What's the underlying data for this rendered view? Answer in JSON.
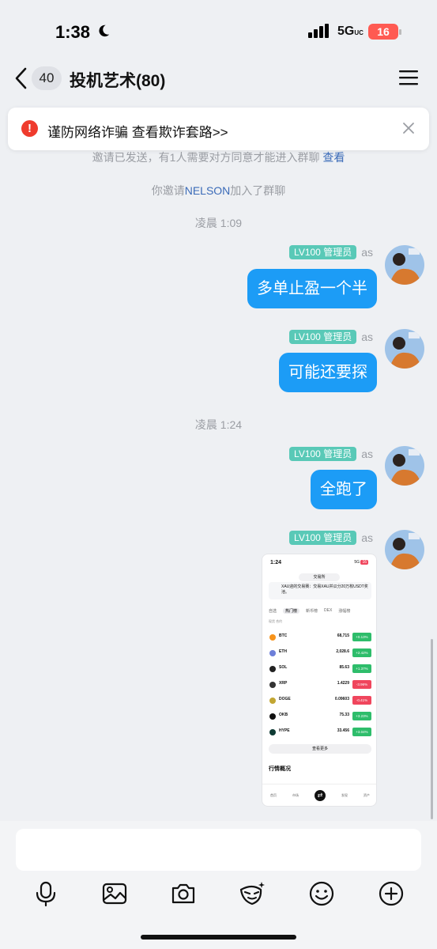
{
  "status_bar": {
    "time": "1:38",
    "network": "5G",
    "network_suffix": "UC",
    "battery": "16"
  },
  "header": {
    "back_count": "40",
    "title": "投机艺术(80)"
  },
  "alert": {
    "text": "谨防网络诈骗 查看欺诈套路>>"
  },
  "system_messages": [
    {
      "text": "邀请已发送，有1人需要对方同意才能进入群聊",
      "link": "查看"
    },
    {
      "text_before": "你邀请",
      "highlight": "NELSON",
      "text_after": "加入了群聊"
    }
  ],
  "time_separators": [
    "凌晨 1:09",
    "凌晨 1:24"
  ],
  "messages": [
    {
      "level": "LV100 管理员",
      "sender": "as",
      "text": "多单止盈一个半"
    },
    {
      "level": "LV100 管理员",
      "sender": "as",
      "text": "可能还要探"
    },
    {
      "level": "LV100 管理员",
      "sender": "as",
      "text": "全跑了"
    },
    {
      "level": "LV100 管理员",
      "sender": "as",
      "type": "image"
    }
  ],
  "shared_screenshot": {
    "time": "1:24",
    "status": "5G",
    "battery": "16",
    "header": "交易所",
    "promo": "XAU迎的交易赛：交易XAU并瓜分20万枚USDT奖池。",
    "tabs": [
      "自选",
      "热门榜",
      "新币榜",
      "DEX",
      "涨幅榜"
    ],
    "active_tab": "热门榜",
    "sub_tabs": "现货  合约",
    "rows": [
      {
        "symbol": "BTC",
        "price": "68,715",
        "change": "+0.13%",
        "dir": "up"
      },
      {
        "symbol": "ETH",
        "price": "2,028.6",
        "change": "+2.42%",
        "dir": "up"
      },
      {
        "symbol": "SOL",
        "price": "85.63",
        "change": "+1.37%",
        "dir": "up"
      },
      {
        "symbol": "XRP",
        "price": "1.4229",
        "change": "-3.96%",
        "dir": "down"
      },
      {
        "symbol": "DOGE",
        "price": "0.09603",
        "change": "-0.41%",
        "dir": "down"
      },
      {
        "symbol": "OKB",
        "price": "75.33",
        "change": "+3.23%",
        "dir": "up"
      },
      {
        "symbol": "HYPE",
        "price": "33.456",
        "change": "+3.04%",
        "dir": "up"
      }
    ],
    "more": "查看更多",
    "section": "行情概况",
    "nav": [
      "首页",
      "市场",
      "⇄",
      "发现",
      "资产"
    ]
  },
  "colors": {
    "bubble": "#1c9cf6",
    "level_tag": "#59c9b7",
    "alert_icon": "#ef3b2d",
    "up": "#2ebd6b",
    "down": "#f0465d"
  },
  "toolbar": {
    "icons": [
      "microphone-icon",
      "image-icon",
      "camera-icon",
      "mask-icon",
      "emoji-icon",
      "plus-icon"
    ]
  }
}
